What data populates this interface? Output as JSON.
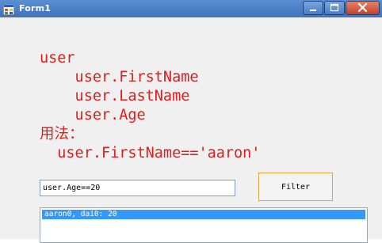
{
  "window": {
    "title": "Form1",
    "icon": "winforms-app-icon",
    "controls": {
      "minimize": "minimize-icon",
      "maximize": "maximize-icon",
      "close": "close-icon"
    }
  },
  "usage_text": {
    "lines": [
      "user",
      "    user.FirstName",
      "    user.LastName",
      "    user.Age",
      "用法：",
      "  user.FirstName=='aaron'"
    ],
    "color": "#e21b1b"
  },
  "filter": {
    "value": "user.Age==20",
    "button_label": "Filter"
  },
  "results": {
    "items": [
      "aaron0, dai0: 20"
    ],
    "selected_index": 0,
    "selection_color": "#3399ff"
  },
  "colors": {
    "titlebar": "#4a7fc8",
    "background": "#f0f0f0",
    "button_border": "#e0a53c",
    "close_button": "#c44128"
  }
}
